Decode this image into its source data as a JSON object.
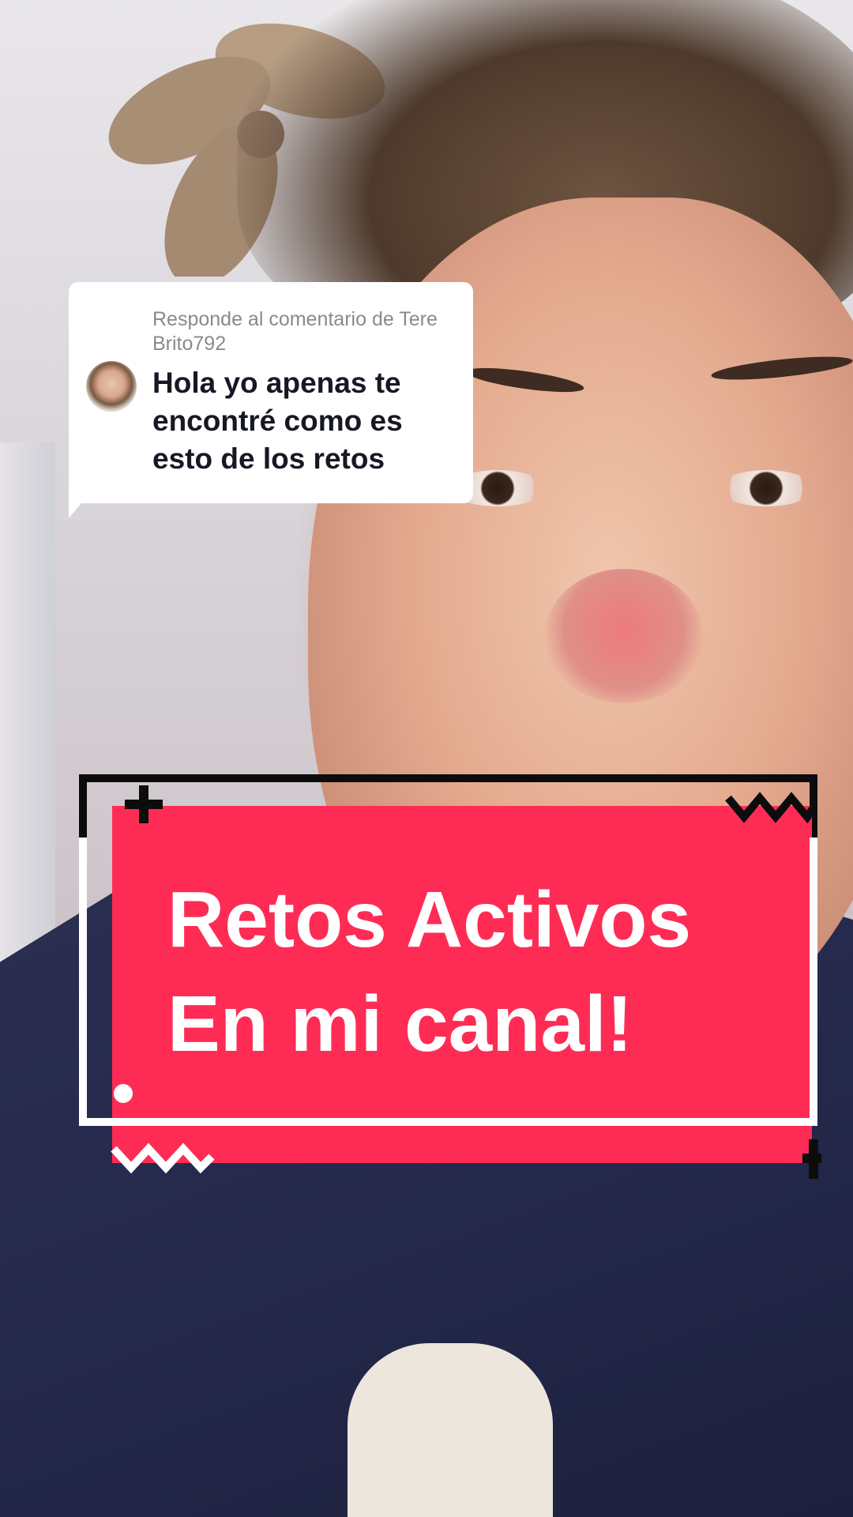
{
  "reply": {
    "header": "Responde al comentario de Tere Brito792",
    "comment": "Hola yo apenas te encontré como es esto de los retos"
  },
  "banner": {
    "line1": "Retos Activos",
    "line2": "En mi canal!"
  },
  "colors": {
    "banner_red": "#fe2c55",
    "card_white": "#ffffff",
    "outline_black": "#0c0c0c"
  },
  "icons": [
    "plus-icon",
    "zigzag-icon",
    "dot-icon"
  ]
}
